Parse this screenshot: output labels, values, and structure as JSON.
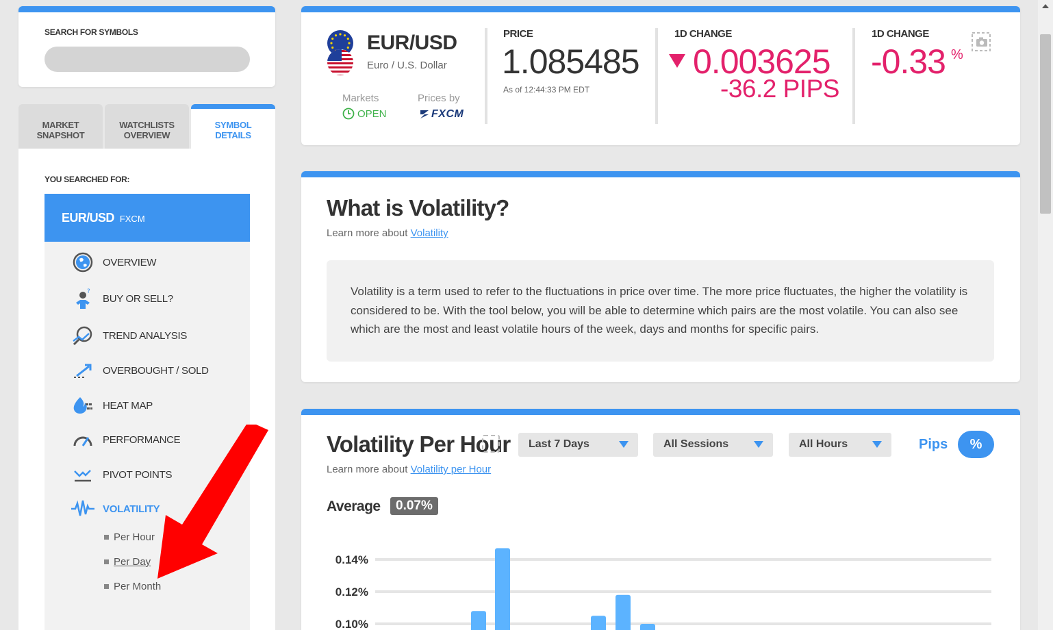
{
  "search": {
    "label": "SEARCH FOR SYMBOLS",
    "placeholder": ""
  },
  "tabs": [
    {
      "label_l1": "MARKET",
      "label_l2": "SNAPSHOT"
    },
    {
      "label_l1": "WATCHLISTS",
      "label_l2": "OVERVIEW"
    },
    {
      "label_l1": "SYMBOL",
      "label_l2": "DETAILS"
    }
  ],
  "left_panel": {
    "searched_label": "YOU SEARCHED FOR:",
    "symbol": "EUR/USD",
    "provider": "FXCM",
    "menu": [
      {
        "label": "OVERVIEW",
        "icon": "globe-icon"
      },
      {
        "label": "BUY OR SELL?",
        "icon": "person-question-icon"
      },
      {
        "label": "TREND ANALYSIS",
        "icon": "magnifier-trend-icon"
      },
      {
        "label": "OVERBOUGHT / SOLD",
        "icon": "arrow-up-dotted-icon"
      },
      {
        "label": "HEAT MAP",
        "icon": "flame-icon"
      },
      {
        "label": "PERFORMANCE",
        "icon": "gauge-icon"
      },
      {
        "label": "PIVOT POINTS",
        "icon": "pivot-chart-icon"
      },
      {
        "label": "VOLATILITY",
        "icon": "pulse-icon"
      }
    ],
    "submenu": [
      "Per Hour",
      "Per Day",
      "Per Month"
    ]
  },
  "quote": {
    "pair": "EUR/USD",
    "pair_name": "Euro / U.S. Dollar",
    "markets_label": "Markets",
    "markets_status": "OPEN",
    "prices_label": "Prices by",
    "provider_logo": "FXCM",
    "price_label": "PRICE",
    "price": "1.085485",
    "as_of": "As of 12:44:33 PM EDT",
    "change_label": "1D CHANGE",
    "change": "0.003625",
    "change_pips": "-36.2 PIPS",
    "pct_label": "1D CHANGE",
    "pct_change": "-0.33",
    "pct_sign": "%"
  },
  "volatility_info": {
    "title": "What is Volatility?",
    "learn_prefix": "Learn more about",
    "learn_link": "Volatility",
    "description": "Volatility is a term used to refer to the fluctuations in price over time. The more price fluctuates, the higher the volatility is considered to be. With the tool below, you will be able to determine which pairs are the most volatile. You can also see which are the most and least volatile hours of the week, days and months for specific pairs."
  },
  "volatility_per_hour": {
    "title": "Volatility Per Hour",
    "learn_prefix": "Learn more about",
    "learn_link": "Volatility per Hour",
    "dropdown_days": "Last 7 Days",
    "dropdown_sessions": "All Sessions",
    "dropdown_hours": "All Hours",
    "pips_label": "Pips",
    "pct_label": "%",
    "average_label": "Average",
    "average_value": "0.07%"
  },
  "chart_data": {
    "type": "bar",
    "y_tick_labels": [
      "0.14%",
      "0.12%",
      "0.10%"
    ],
    "y_ticks": [
      0.14,
      0.12,
      0.1
    ],
    "visible_range": [
      0.095,
      0.145
    ],
    "values": [
      0.108,
      0.147,
      0.105,
      0.118,
      0.1
    ]
  },
  "colors": {
    "accent": "#3d94f0",
    "negative": "#e3216b",
    "positive": "#3fb24a",
    "annotation": "#ff0000"
  }
}
